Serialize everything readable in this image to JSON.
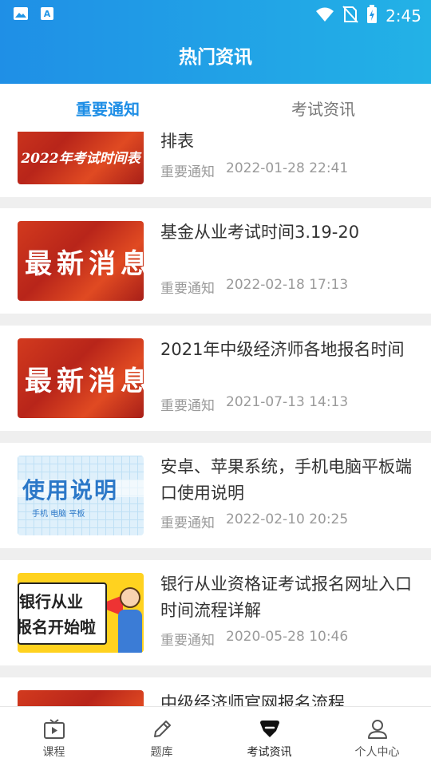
{
  "status_bar": {
    "time": "2:45"
  },
  "header": {
    "title": "热门资讯"
  },
  "tabs": [
    {
      "label": "重要通知",
      "active": true
    },
    {
      "label": "考试资讯",
      "active": false
    }
  ],
  "articles": [
    {
      "title": "排表",
      "category": "重要通知",
      "datetime": "2022-01-28 22:41",
      "thumb_text": "2022年考试时间表"
    },
    {
      "title": "基金从业考试时间3.19-20",
      "category": "重要通知",
      "datetime": "2022-02-18 17:13",
      "thumb_text": "最新消息"
    },
    {
      "title": "2021年中级经济师各地报名时间",
      "category": "重要通知",
      "datetime": "2021-07-13 14:13",
      "thumb_text": "最新消息"
    },
    {
      "title": "安卓、苹果系统，手机电脑平板端口使用说明",
      "category": "重要通知",
      "datetime": "2022-02-10 20:25",
      "thumb_text": "使用说明",
      "thumb_sub": "手机  电脑  平板"
    },
    {
      "title": "银行从业资格证考试报名网址入口时间流程详解",
      "category": "重要通知",
      "datetime": "2020-05-28 10:46",
      "thumb_text_1": "银行从业",
      "thumb_text_2": "报名开始啦"
    },
    {
      "title": "中级经济师官网报名流程",
      "category": "",
      "datetime": ""
    }
  ],
  "bottom_nav": [
    {
      "label": "课程",
      "icon": "play-tv-icon"
    },
    {
      "label": "题库",
      "icon": "pencil-icon"
    },
    {
      "label": "考试资讯",
      "icon": "news-badge-icon",
      "active": true
    },
    {
      "label": "个人中心",
      "icon": "user-icon"
    }
  ],
  "colors": {
    "accent": "#1e8ee6",
    "header_start": "#1f8fe6",
    "header_end": "#23b2e6"
  }
}
